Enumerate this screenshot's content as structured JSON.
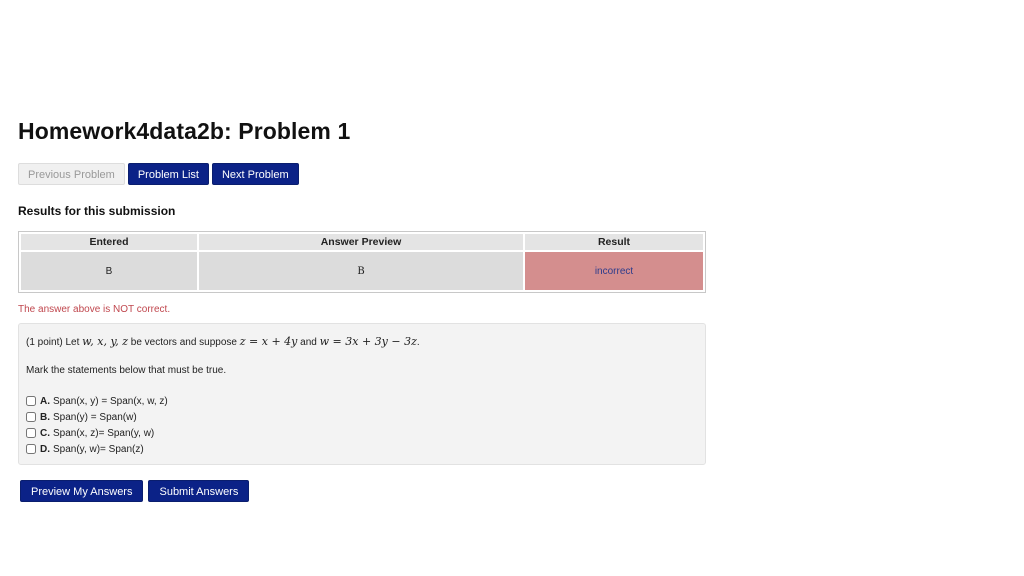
{
  "page": {
    "title": "Homework4data2b: Problem 1"
  },
  "nav": {
    "previous": "Previous Problem",
    "list": "Problem List",
    "next": "Next Problem"
  },
  "results": {
    "heading": "Results for this submission",
    "columns": [
      "Entered",
      "Answer Preview",
      "Result"
    ],
    "row": {
      "entered": "B",
      "preview": "B",
      "result": "incorrect"
    },
    "feedback": "The answer above is NOT correct."
  },
  "problem": {
    "points": "(1 point) Let",
    "vars": "w, x, y, z",
    "mid": "be vectors and suppose",
    "eq1": "z = x + 4y",
    "and": "and",
    "eq2": "w = 3x + 3y − 3z",
    "end": ".",
    "instruction": "Mark the statements below that must be true.",
    "options": [
      {
        "letter": "A.",
        "text": "Span(x, y) = Span(x, w, z)",
        "checked": false
      },
      {
        "letter": "B.",
        "text": "Span(y) = Span(w)",
        "checked": false
      },
      {
        "letter": "C.",
        "text": "Span(x, z)= Span(y, w)",
        "checked": false
      },
      {
        "letter": "D.",
        "text": "Span(y, w)= Span(z)",
        "checked": false
      }
    ]
  },
  "actions": {
    "preview": "Preview My Answers",
    "submit": "Submit Answers"
  },
  "colors": {
    "button": "#0b2287",
    "incorrect_bg": "#d48e8e",
    "error_text": "#c0474e"
  }
}
